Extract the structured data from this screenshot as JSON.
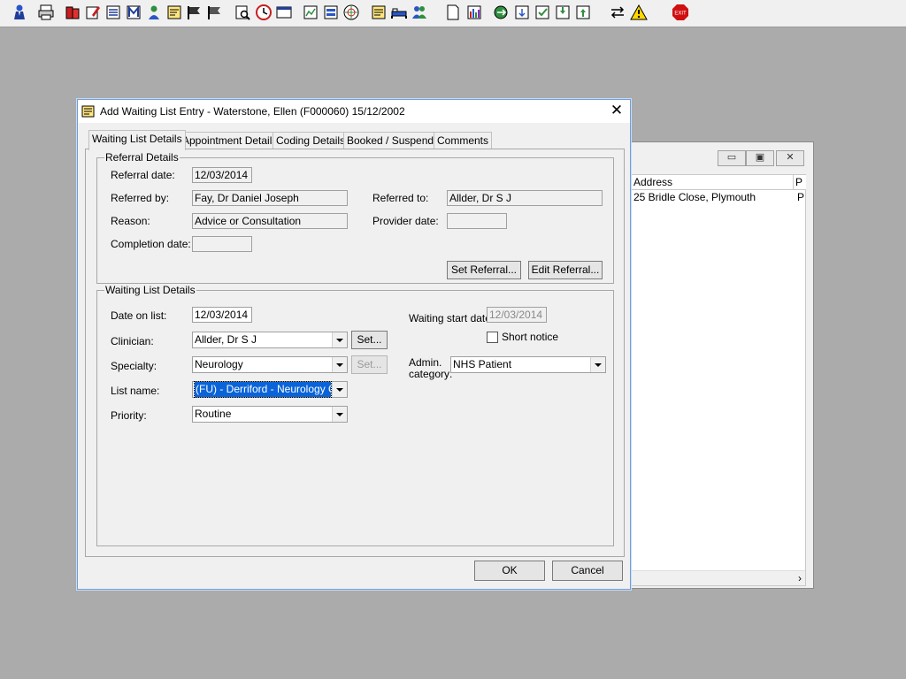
{
  "toolbar": {
    "buttons": [
      "person-icon",
      "printer-icon",
      "books-icon",
      "notepad-edit-icon",
      "list-icon",
      "m-icon",
      "user-icon",
      "note-icon",
      "flag-icon",
      "flag2-icon",
      "search-doc-icon",
      "clock-icon",
      "window-icon",
      "chart-doc-icon",
      "form-icon",
      "globe-doc-icon",
      "sticky-note-icon",
      "bed-icon",
      "people-icon",
      "blank-page-icon",
      "bar-chart-icon",
      "globe-arrow-icon",
      "arrow-doc-icon",
      "check-doc-icon",
      "download-doc-icon",
      "upload-doc-icon",
      "exchange-icon",
      "warning-icon",
      "exit-icon"
    ],
    "exit_label": "EXIT"
  },
  "background_window": {
    "columns": [
      "Address",
      "P"
    ],
    "rows": [
      {
        "address": "25 Bridle Close, Plymouth",
        "p": "P"
      }
    ],
    "scroll_arrow": "›"
  },
  "dialog": {
    "title": "Add Waiting List Entry - Waterstone, Ellen (F000060) 15/12/2002",
    "close": "✕",
    "tabs": [
      "Waiting List Details",
      "Appointment Details",
      "Coding Details",
      "Booked / Suspend",
      "Comments"
    ],
    "referral": {
      "group_label": "Referral Details",
      "referral_date_label": "Referral date:",
      "referral_date": "12/03/2014",
      "referred_by_label": "Referred by:",
      "referred_by": "Fay, Dr Daniel Joseph",
      "referred_to_label": "Referred to:",
      "referred_to": "Allder, Dr S J",
      "reason_label": "Reason:",
      "reason": "Advice or Consultation",
      "provider_date_label": "Provider date:",
      "provider_date": "",
      "completion_date_label": "Completion date:",
      "completion_date": "",
      "set_referral": "Set Referral...",
      "edit_referral": "Edit Referral..."
    },
    "waiting": {
      "group_label": "Waiting List Details",
      "date_on_list_label": "Date on list:",
      "date_on_list": "12/03/2014",
      "waiting_start_label": "Waiting start date:",
      "waiting_start": "12/03/2014",
      "short_notice_label": "Short notice",
      "clinician_label": "Clinician:",
      "clinician": "Allder, Dr S J",
      "clinician_set": "Set...",
      "specialty_label": "Specialty:",
      "specialty": "Neurology",
      "specialty_set": "Set...",
      "admin_label_1": "Admin.",
      "admin_label_2": "category:",
      "admin_category": "NHS Patient",
      "list_name_label": "List name:",
      "list_name": "(FU) - Derriford - Neurology OPD",
      "priority_label": "Priority:",
      "priority": "Routine"
    },
    "ok": "OK",
    "cancel": "Cancel"
  }
}
